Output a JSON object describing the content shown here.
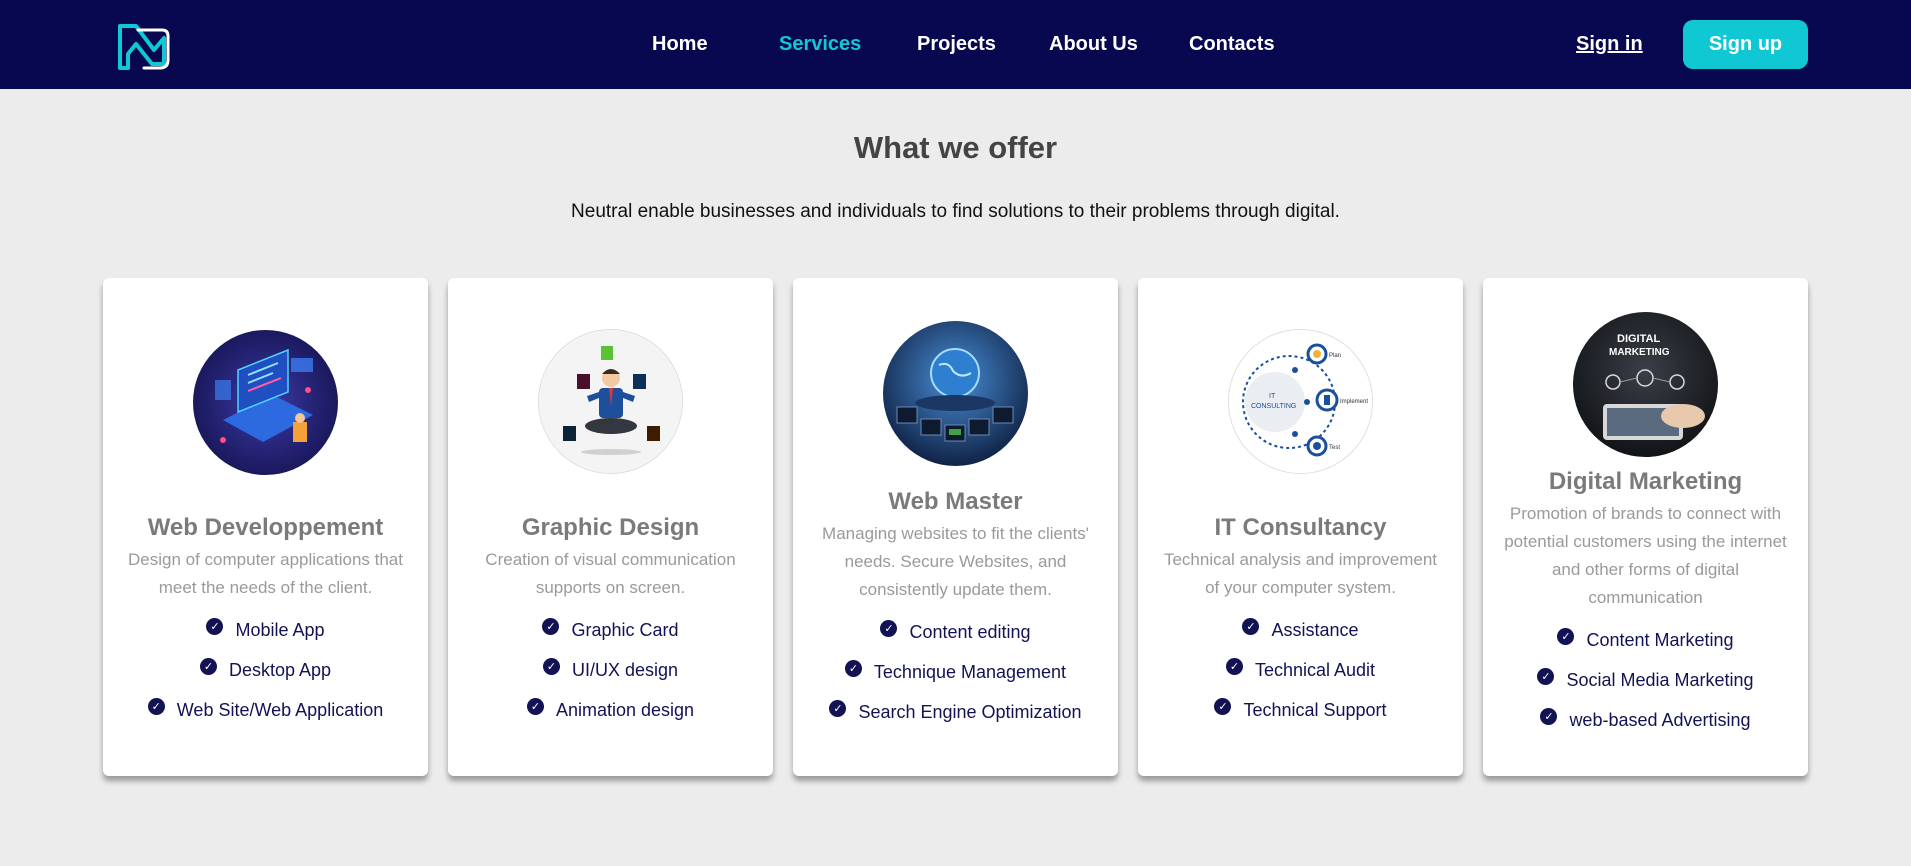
{
  "nav": {
    "links": [
      {
        "label": "Home"
      },
      {
        "label": "Services"
      },
      {
        "label": "Projects"
      },
      {
        "label": "About Us"
      },
      {
        "label": "Contacts"
      }
    ],
    "active": "Services",
    "signin_label": "Sign in",
    "signup_label": "Sign up"
  },
  "section": {
    "title": "What we offer",
    "subtitle": "Neutral enable businesses and individuals to find solutions to their problems through digital."
  },
  "cards": [
    {
      "title": "Web Developpement",
      "description": "Design of computer applications that meet the needs of the client.",
      "features": [
        "Mobile App",
        "Desktop App",
        "Web Site/Web Application"
      ]
    },
    {
      "title": "Graphic Design",
      "description": "Creation of visual communication supports on screen.",
      "features": [
        "Graphic Card",
        "UI/UX design",
        "Animation design"
      ]
    },
    {
      "title": "Web Master",
      "description": "Managing websites to fit the clients' needs. Secure Websites, and consistently update them.",
      "features": [
        "Content editing",
        "Technique Management",
        "Search Engine Optimization"
      ]
    },
    {
      "title": "IT Consultancy",
      "description": "Technical analysis and improvement of your computer system.",
      "features": [
        "Assistance",
        "Technical Audit",
        "Technical Support"
      ]
    },
    {
      "title": "Digital Marketing",
      "description": "Promotion of brands to connect with potential customers using the internet and other forms of digital communication",
      "features": [
        "Content Marketing",
        "Social Media Marketing",
        "web-based Advertising"
      ]
    }
  ],
  "image_text": {
    "it_consulting": [
      "IT",
      "CONSULTING"
    ],
    "it_steps": [
      "Plan",
      "Implement",
      "Test"
    ],
    "digital_marketing": [
      "DIGITAL",
      "MARKETING"
    ]
  },
  "colors": {
    "navbar_bg": "#080850",
    "accent": "#10c8d4",
    "page_bg": "#ececec",
    "feature_text": "#121255"
  },
  "icons": {
    "logo": "brand-logo-icon",
    "check": "check-circle-icon"
  }
}
